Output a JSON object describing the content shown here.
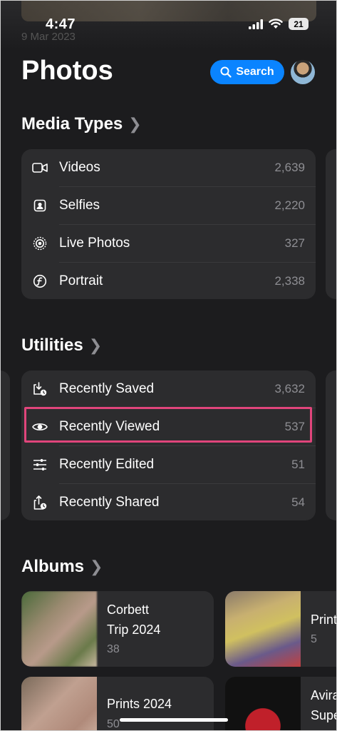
{
  "status_bar": {
    "time": "4:47",
    "battery": "21"
  },
  "background_date": "9 Mar 2023",
  "header": {
    "title": "Photos",
    "search_label": "Search"
  },
  "media_types": {
    "title": "Media Types",
    "items": [
      {
        "label": "Videos",
        "count": "2,639",
        "icon": "video-icon"
      },
      {
        "label": "Selfies",
        "count": "2,220",
        "icon": "selfie-icon"
      },
      {
        "label": "Live Photos",
        "count": "327",
        "icon": "live-photo-icon"
      },
      {
        "label": "Portrait",
        "count": "2,338",
        "icon": "portrait-icon"
      }
    ]
  },
  "utilities": {
    "title": "Utilities",
    "items": [
      {
        "label": "Recently Saved",
        "count": "3,632",
        "icon": "recently-saved-icon"
      },
      {
        "label": "Recently Viewed",
        "count": "537",
        "icon": "eye-icon"
      },
      {
        "label": "Recently Edited",
        "count": "51",
        "icon": "sliders-icon"
      },
      {
        "label": "Recently Shared",
        "count": "54",
        "icon": "share-icon"
      }
    ]
  },
  "albums": {
    "title": "Albums",
    "items": [
      {
        "name_line1": "Corbett",
        "name_line2": "Trip 2024",
        "count": "38"
      },
      {
        "name_line1": "Print",
        "count": "5"
      },
      {
        "name_line1": "Prints 2024",
        "count": "50"
      },
      {
        "name_line1": "Avira",
        "name_line2": "Supe"
      }
    ]
  },
  "colors": {
    "accent": "#0a84ff",
    "highlight": "#e0457b",
    "card": "#2c2c2e",
    "background": "#1c1c1e"
  }
}
